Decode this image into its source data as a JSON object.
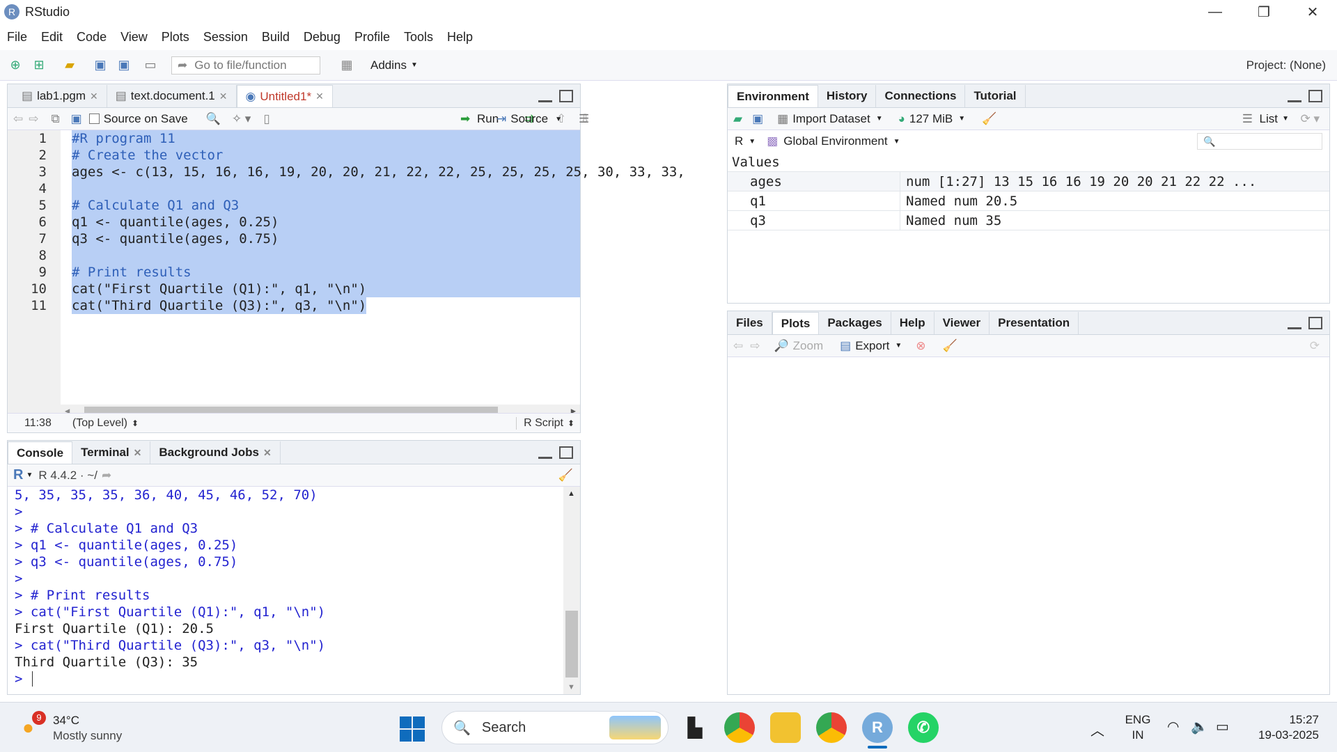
{
  "window": {
    "title": "RStudio",
    "minimize": "—",
    "restore": "❐",
    "close": "✕"
  },
  "menu": [
    "File",
    "Edit",
    "Code",
    "View",
    "Plots",
    "Session",
    "Build",
    "Debug",
    "Profile",
    "Tools",
    "Help"
  ],
  "toolbar": {
    "goto_placeholder": "Go to file/function",
    "addins": "Addins",
    "project": "Project: (None)"
  },
  "editor": {
    "tabs": [
      {
        "label": "lab1.pgm"
      },
      {
        "label": "text.document.1"
      },
      {
        "label": "Untitled1*"
      }
    ],
    "source_on_save": "Source on Save",
    "run": "Run",
    "source": "Source",
    "cursor_pos": "11:38",
    "scope": "(Top Level)",
    "filetype": "R Script",
    "lines": [
      {
        "n": "1",
        "text": "#R program 11"
      },
      {
        "n": "2",
        "text": "# Create the vector"
      },
      {
        "n": "3",
        "text": "ages <- c(13, 15, 16, 16, 19, 20, 20, 21, 22, 22, 25, 25, 25, 25, 30, 33, 33,"
      },
      {
        "n": "4",
        "text": ""
      },
      {
        "n": "5",
        "text": "# Calculate Q1 and Q3"
      },
      {
        "n": "6",
        "text": "q1 <- quantile(ages, 0.25)"
      },
      {
        "n": "7",
        "text": "q3 <- quantile(ages, 0.75)"
      },
      {
        "n": "8",
        "text": ""
      },
      {
        "n": "9",
        "text": "# Print results"
      },
      {
        "n": "10",
        "text": "cat(\"First Quartile (Q1):\", q1, \"\\n\")"
      },
      {
        "n": "11",
        "text": "cat(\"Third Quartile (Q3):\", q3, \"\\n\")"
      }
    ]
  },
  "console": {
    "tabs": [
      "Console",
      "Terminal",
      "Background Jobs"
    ],
    "rversion": "R 4.4.2 · ~/",
    "lines": [
      "5, 35, 35, 35, 36, 40, 45, 46, 52, 70)",
      ">",
      "> # Calculate Q1 and Q3",
      "> q1 <- quantile(ages, 0.25)",
      "> q3 <- quantile(ages, 0.75)",
      ">",
      "> # Print results",
      "> cat(\"First Quartile (Q1):\", q1, \"\\n\")",
      "First Quartile (Q1): 20.5",
      "> cat(\"Third Quartile (Q3):\", q3, \"\\n\")",
      "Third Quartile (Q3): 35",
      "> "
    ]
  },
  "environment": {
    "tabs": [
      "Environment",
      "History",
      "Connections",
      "Tutorial"
    ],
    "import": "Import Dataset",
    "memory": "127 MiB",
    "view": "List",
    "lang": "R",
    "scope": "Global Environment",
    "section": "Values",
    "rows": [
      {
        "name": "ages",
        "value": "num [1:27] 13 15 16 16 19 20 20 21 22 22 ..."
      },
      {
        "name": "q1",
        "value": "Named num 20.5"
      },
      {
        "name": "q3",
        "value": "Named num 35"
      }
    ]
  },
  "files": {
    "tabs": [
      "Files",
      "Plots",
      "Packages",
      "Help",
      "Viewer",
      "Presentation"
    ],
    "zoom": "Zoom",
    "export": "Export"
  },
  "taskbar": {
    "temp": "34°C",
    "weather": "Mostly sunny",
    "weather_badge": "9",
    "search": "Search",
    "lang1": "ENG",
    "lang2": "IN",
    "time": "15:27",
    "date": "19-03-2025"
  }
}
